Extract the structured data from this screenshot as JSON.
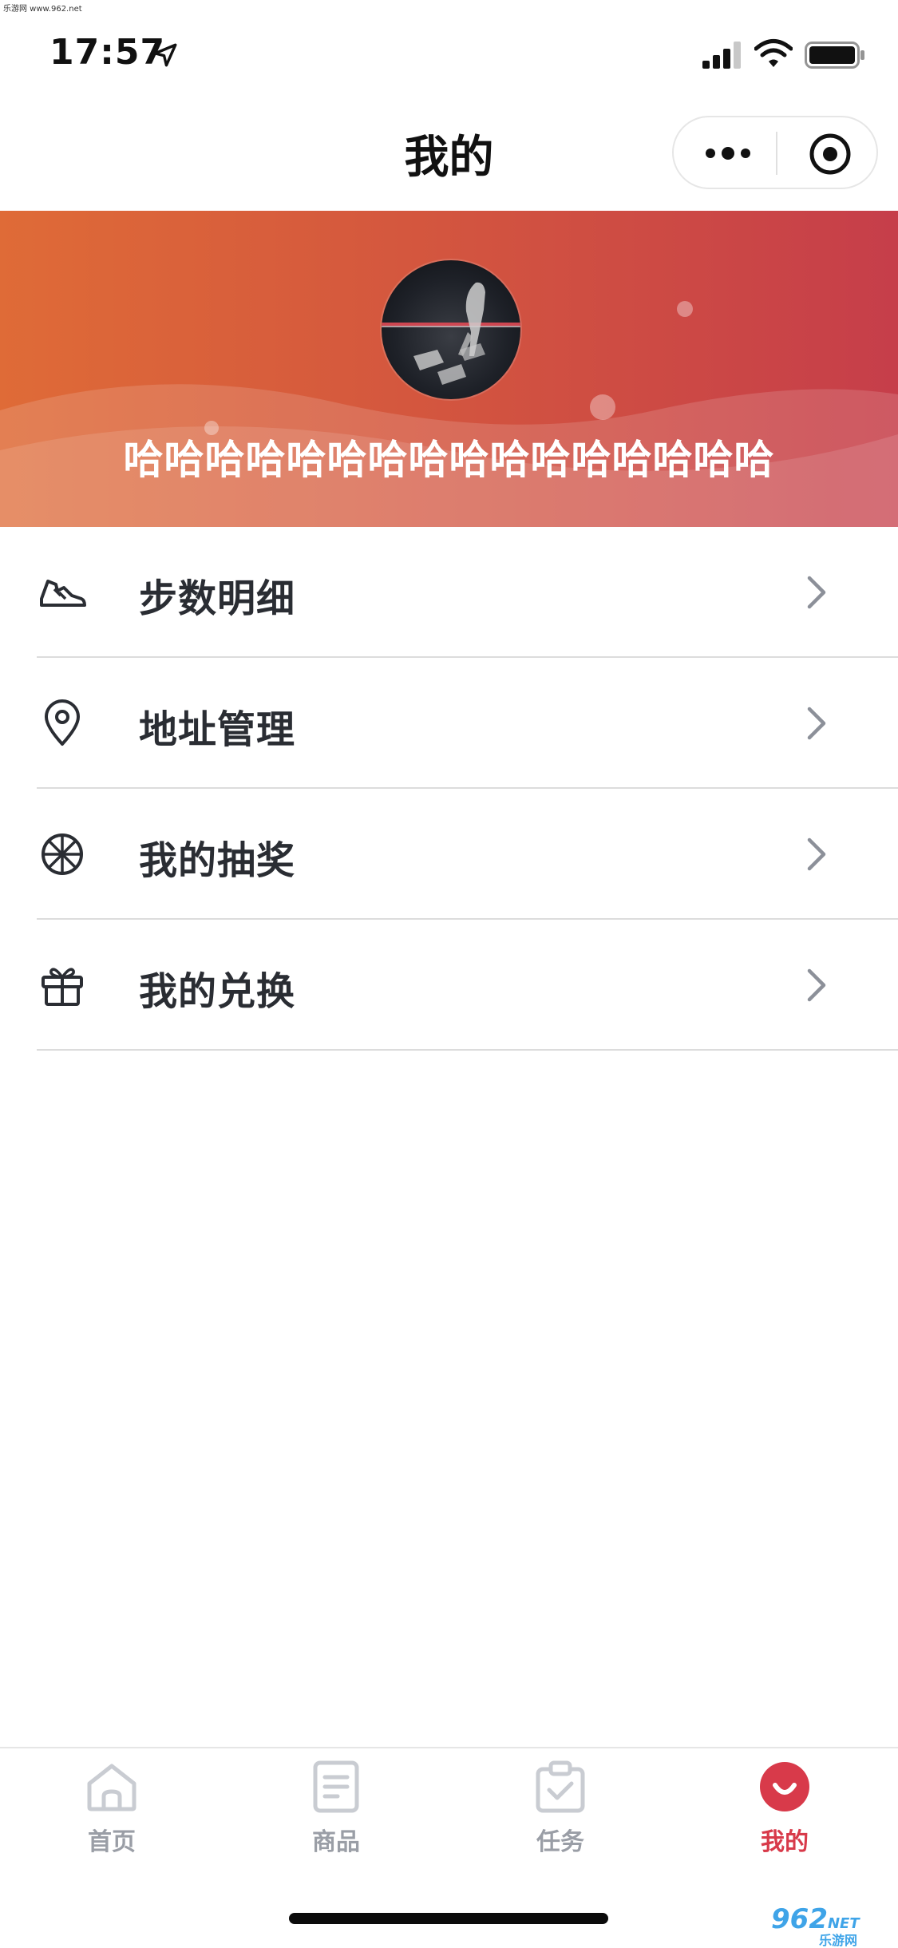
{
  "watermark_top": "乐游网 www.962.net",
  "status_bar": {
    "time": "17:57"
  },
  "nav": {
    "title": "我的"
  },
  "profile": {
    "username": "哈哈哈哈哈哈哈哈哈哈哈哈哈哈哈哈"
  },
  "menu": {
    "items": [
      {
        "label": "步数明细",
        "icon": "sneaker-icon"
      },
      {
        "label": "地址管理",
        "icon": "location-pin-icon"
      },
      {
        "label": "我的抽奖",
        "icon": "lottery-wheel-icon"
      },
      {
        "label": "我的兑换",
        "icon": "gift-icon"
      }
    ]
  },
  "tabbar": {
    "items": [
      {
        "label": "首页",
        "icon": "home-icon",
        "active": false
      },
      {
        "label": "商品",
        "icon": "document-icon",
        "active": false
      },
      {
        "label": "任务",
        "icon": "task-clipboard-icon",
        "active": false
      },
      {
        "label": "我的",
        "icon": "profile-smile-icon",
        "active": true
      }
    ]
  },
  "watermark_bottom": {
    "text": "962",
    "suffix": "NET",
    "sub": "乐游网"
  },
  "colors": {
    "accent": "#d83a4a",
    "banner_start": "#df6b37",
    "banner_end": "#c63e4a",
    "text_primary": "#2a2d33",
    "tab_inactive": "#9a9ea6"
  }
}
